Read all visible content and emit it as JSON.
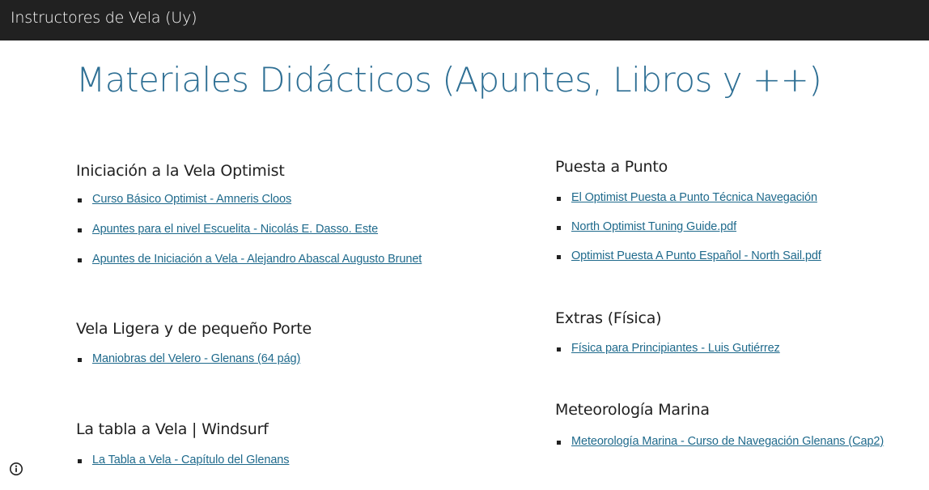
{
  "header": {
    "site_title": "Instructores de Vela (Uy)"
  },
  "page": {
    "title": "Materiales Didácticos (Apuntes, Libros y ++)"
  },
  "left_column": [
    {
      "heading": "Iniciación a la Vela Optimist",
      "links": [
        "Curso Básico Optimist - Amneris Cloos",
        "Apuntes para el nivel Escuelita - Nicolás E. Dasso.  Este ",
        "Apuntes de Iniciación a Vela - Alejandro Abascal Augusto Brunet"
      ]
    },
    {
      "heading": "Vela Ligera y de pequeño Porte",
      "links": [
        "Maniobras del Velero - Glenans (64 pág)"
      ]
    },
    {
      "heading": "La tabla a Vela | Windsurf",
      "links": [
        "La Tabla a Vela - Capítulo del Glenans"
      ]
    }
  ],
  "right_column": [
    {
      "heading": "Puesta a Punto",
      "links": [
        "El Optimist Puesta a Punto Técnica Navegación",
        "North Optimist Tuning Guide.pdf",
        "Optimist Puesta A Punto Español - North Sail.pdf"
      ]
    },
    {
      "heading": "Extras (Física)",
      "links": [
        "Física para Principiantes - Luis Gutiérrez"
      ]
    },
    {
      "heading": "Meteorología Marina",
      "links": [
        "Meteorología Marina - Curso de Navegación Glenans (Cap2)"
      ]
    }
  ],
  "footer": {
    "info_icon": "info-circle-icon"
  }
}
